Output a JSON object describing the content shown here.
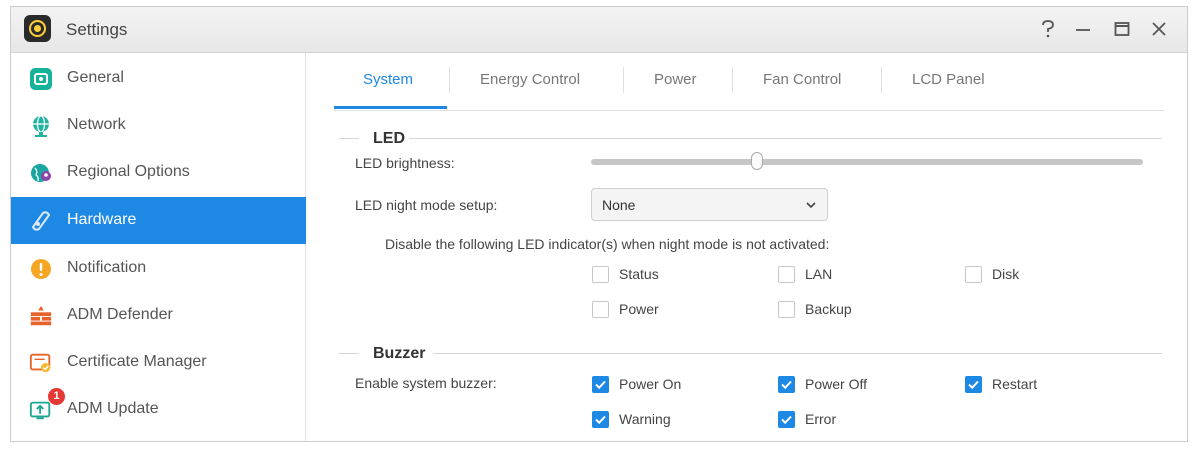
{
  "window": {
    "title": "Settings"
  },
  "titlebar": {
    "help_icon": "help-icon",
    "minimize_icon": "minimize-icon",
    "maximize_icon": "maximize-icon",
    "close_icon": "close-icon"
  },
  "sidebar": {
    "items": [
      {
        "label": "General",
        "icon": "general-icon"
      },
      {
        "label": "Network",
        "icon": "network-globe-icon"
      },
      {
        "label": "Regional Options",
        "icon": "regional-globe-icon"
      },
      {
        "label": "Hardware",
        "icon": "hardware-icon",
        "active": true
      },
      {
        "label": "Notification",
        "icon": "notification-icon"
      },
      {
        "label": "ADM Defender",
        "icon": "defender-icon"
      },
      {
        "label": "Certificate Manager",
        "icon": "certificate-icon"
      },
      {
        "label": "ADM Update",
        "icon": "update-icon",
        "badge": "1"
      }
    ]
  },
  "tabs": [
    {
      "label": "System",
      "active": true
    },
    {
      "label": "Energy Control"
    },
    {
      "label": "Power"
    },
    {
      "label": "Fan Control"
    },
    {
      "label": "LCD Panel"
    }
  ],
  "led": {
    "heading": "LED",
    "brightness_label": "LED brightness:",
    "brightness_level": 0.3,
    "night_mode_label": "LED night mode setup:",
    "night_mode_value": "None",
    "disable_text": "Disable the following LED indicator(s) when night mode is not activated:",
    "indicators": [
      {
        "label": "Status",
        "checked": false
      },
      {
        "label": "LAN",
        "checked": false
      },
      {
        "label": "Disk",
        "checked": false
      },
      {
        "label": "Power",
        "checked": false
      },
      {
        "label": "Backup",
        "checked": false
      }
    ]
  },
  "buzzer": {
    "heading": "Buzzer",
    "enable_label": "Enable system buzzer:",
    "options": [
      {
        "label": "Power On",
        "checked": true
      },
      {
        "label": "Power Off",
        "checked": true
      },
      {
        "label": "Restart",
        "checked": true
      },
      {
        "label": "Warning",
        "checked": true
      },
      {
        "label": "Error",
        "checked": true
      }
    ]
  },
  "colors": {
    "accent": "#1e88e5"
  }
}
